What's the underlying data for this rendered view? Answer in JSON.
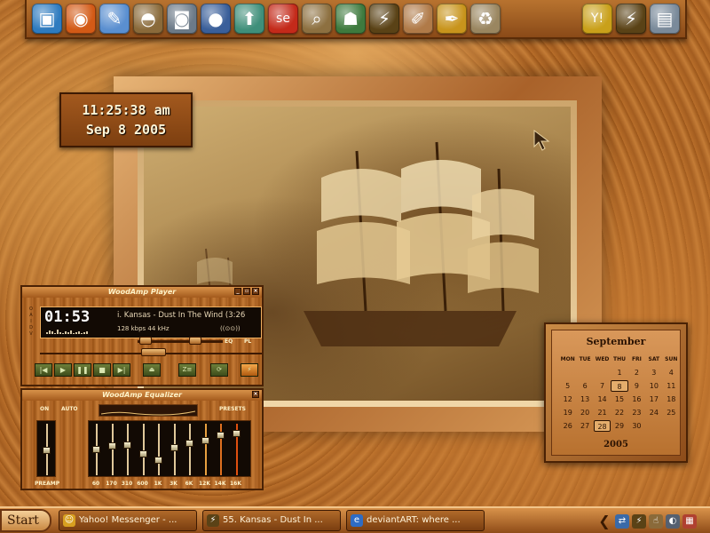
{
  "dock": {
    "icons": [
      {
        "name": "desktop-icon",
        "glyph": "▣",
        "bg": "#2e7bbf"
      },
      {
        "name": "firefox-icon",
        "glyph": "◉",
        "bg": "#d35a16"
      },
      {
        "name": "tools-icon",
        "glyph": "✎",
        "bg": "#5a8fd0"
      },
      {
        "name": "dome-icon",
        "glyph": "◓",
        "bg": "#8a6a3a"
      },
      {
        "name": "camera-icon",
        "glyph": "◙",
        "bg": "#6c7a88"
      },
      {
        "name": "microphone-icon",
        "glyph": "●",
        "bg": "#3a5f9a"
      },
      {
        "name": "upload-icon",
        "glyph": "⬆",
        "bg": "#3f8f7a"
      },
      {
        "name": "se-icon",
        "glyph": "se",
        "bg": "#c42a1a"
      },
      {
        "name": "search-icon",
        "glyph": "⌕",
        "bg": "#8d7040"
      },
      {
        "name": "security-user-icon",
        "glyph": "☗",
        "bg": "#3e7a3e"
      },
      {
        "name": "winamp-icon",
        "glyph": "⚡",
        "bg": "#5a4216"
      },
      {
        "name": "paint-icon",
        "glyph": "✐",
        "bg": "#b07a48"
      },
      {
        "name": "pen-icon",
        "glyph": "✒",
        "bg": "#c8941c"
      },
      {
        "name": "trash-icon",
        "glyph": "♻",
        "bg": "#9a8660"
      },
      {
        "name": "yahoo-icon",
        "glyph": "Y!",
        "bg": "#c9a01a"
      },
      {
        "name": "winamp2-icon",
        "glyph": "⚡",
        "bg": "#5a4216"
      },
      {
        "name": "monitor-icon",
        "glyph": "▤",
        "bg": "#7a8a9a"
      }
    ]
  },
  "clock": {
    "time": "11:25:38 am",
    "date": "Sep 8 2005"
  },
  "player": {
    "title": "WoodAmp Player",
    "time": "01:53",
    "track": "i. Kansas - Dust In The Wind (3:26",
    "kbps": "128 kbps  44 kHz",
    "stereo": "((⊙⊙))",
    "eq_label": "EQ",
    "pl_label": "PL",
    "btn_prev": "|◀",
    "btn_play": "▶",
    "btn_pause": "❚❚",
    "btn_stop": "■",
    "btn_next": "▶|",
    "btn_eject": "⏏",
    "btn_shuffle": "Z≡",
    "btn_repeat": "⟳"
  },
  "equalizer": {
    "title": "WoodAmp Equalizer",
    "on": "ON",
    "auto": "AUTO",
    "presets": "PRESETS",
    "preamp": "PREAMP",
    "bands": [
      {
        "label": "60",
        "level": 0.5
      },
      {
        "label": "170",
        "level": 0.42
      },
      {
        "label": "310",
        "level": 0.4
      },
      {
        "label": "600",
        "level": 0.6
      },
      {
        "label": "1K",
        "level": 0.74
      },
      {
        "label": "3K",
        "level": 0.46
      },
      {
        "label": "6K",
        "level": 0.36
      },
      {
        "label": "12K",
        "level": 0.3
      },
      {
        "label": "14K",
        "level": 0.18
      },
      {
        "label": "16K",
        "level": 0.14
      }
    ],
    "band_colors": [
      "#e0c89a",
      "#e0c89a",
      "#e0c89a",
      "#e0c89a",
      "#e0c89a",
      "#e0c89a",
      "#e0c89a",
      "#e8a040",
      "#e07020",
      "#e05010"
    ]
  },
  "calendar": {
    "month": "September",
    "year": "2005",
    "weekdays": [
      "MON",
      "TUE",
      "WED",
      "THU",
      "FRI",
      "SAT",
      "SUN"
    ],
    "days": [
      "",
      "",
      "",
      "1",
      "2",
      "3",
      "4",
      "5",
      "6",
      "7",
      "8",
      "9",
      "10",
      "11",
      "12",
      "13",
      "14",
      "15",
      "16",
      "17",
      "18",
      "19",
      "20",
      "21",
      "22",
      "23",
      "24",
      "25",
      "26",
      "27",
      "28",
      "29",
      "30",
      "",
      ""
    ],
    "highlighted": [
      "8",
      "28"
    ]
  },
  "taskbar": {
    "start": "Start",
    "tasks": [
      {
        "label": "Yahoo! Messenger - ...",
        "icon": "☺",
        "color": "#d8a020"
      },
      {
        "label": "55. Kansas - Dust In ...",
        "icon": "⚡",
        "color": "#5a4216"
      },
      {
        "label": "deviantART: where ...",
        "icon": "e",
        "color": "#2e6cc4"
      }
    ],
    "tray": [
      {
        "name": "network-icon",
        "glyph": "⇄",
        "bg": "#3a6aa8"
      },
      {
        "name": "winamp-tray-icon",
        "glyph": "⚡",
        "bg": "#5a4216"
      },
      {
        "name": "hand-cursor-icon",
        "glyph": "☝",
        "bg": "#8a6a3a"
      },
      {
        "name": "volume-icon",
        "glyph": "◐",
        "bg": "#556070"
      },
      {
        "name": "firewall-icon",
        "glyph": "▦",
        "bg": "#b04030"
      }
    ]
  }
}
